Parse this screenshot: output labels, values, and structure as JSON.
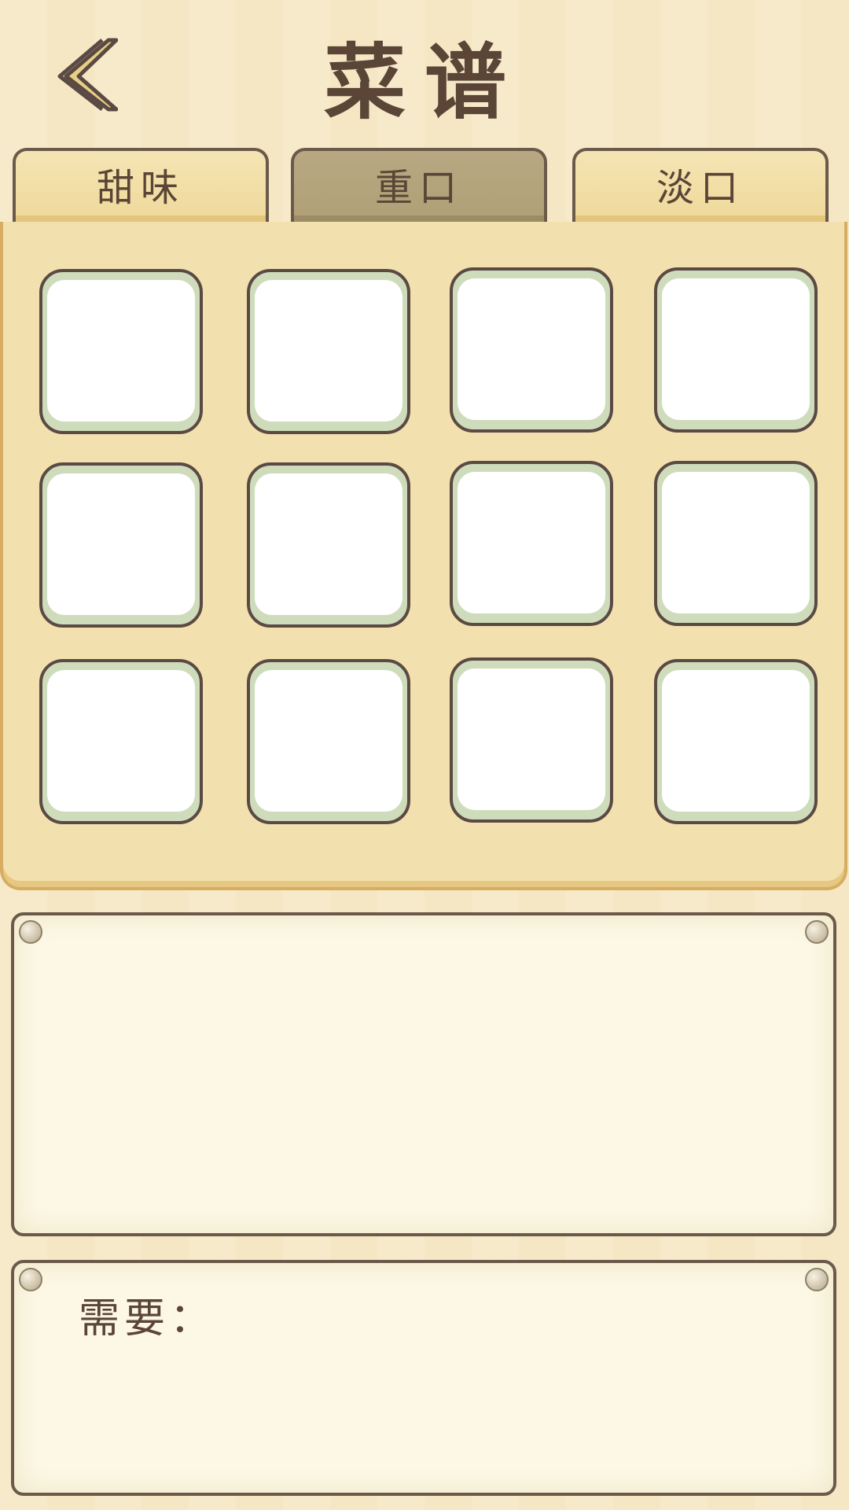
{
  "header": {
    "title": "菜谱",
    "back_icon": "chevron-left-icon"
  },
  "tabs": [
    {
      "label": "甜味",
      "active": false
    },
    {
      "label": "重口",
      "active": true
    },
    {
      "label": "淡口",
      "active": false
    }
  ],
  "recipe_slots": {
    "rows": 3,
    "columns": 4,
    "filled": 0
  },
  "info_panel": {
    "content": ""
  },
  "requirement_panel": {
    "label": "需要："
  },
  "colors": {
    "background": "#f6e9c8",
    "board": "#f2e1ae",
    "tab_active": "#b09f76",
    "slot_frame": "#cfdcbc",
    "text": "#5a4536"
  }
}
